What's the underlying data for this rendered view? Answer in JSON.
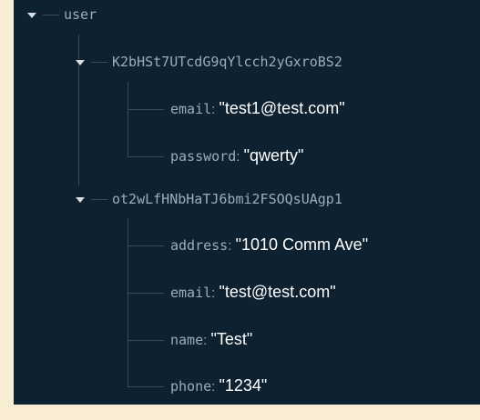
{
  "root": {
    "label": "user"
  },
  "nodes": [
    {
      "label": "K2bHSt7UTcdG9qYlcch2yGxroBS2",
      "fields": [
        {
          "key": "email",
          "value": "\"test1@test.com\""
        },
        {
          "key": "password",
          "value": "\"qwerty\""
        }
      ]
    },
    {
      "label": "ot2wLfHNbHaTJ6bmi2FSOQsUAgp1",
      "fields": [
        {
          "key": "address",
          "value": "\"1010 Comm Ave\""
        },
        {
          "key": "email",
          "value": "\"test@test.com\""
        },
        {
          "key": "name",
          "value": "\"Test\""
        },
        {
          "key": "phone",
          "value": "\"1234\""
        }
      ]
    }
  ],
  "colors": {
    "page_background": "#f8ecd3",
    "panel": "#0d2130",
    "key_text": "#9eacb7",
    "value_text": "#ffffff",
    "tree_lines": "#3a4b57"
  }
}
